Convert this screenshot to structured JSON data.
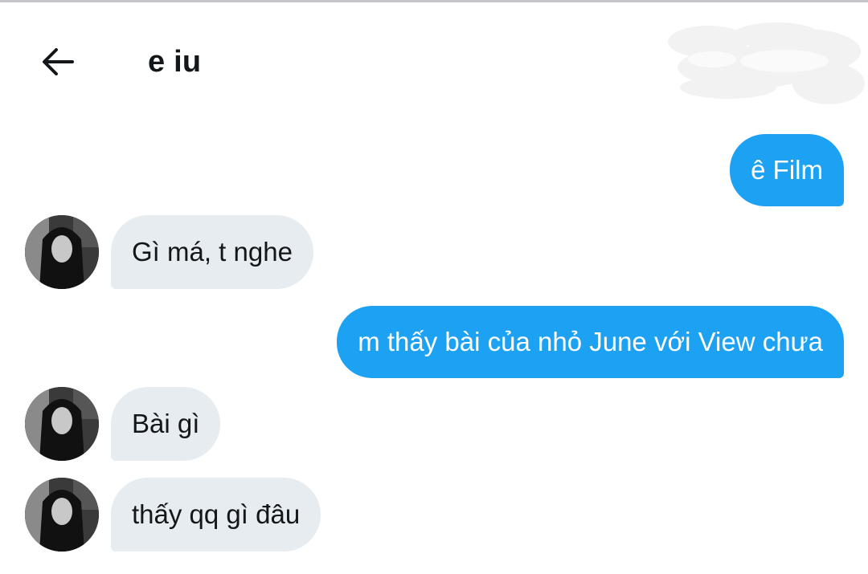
{
  "header": {
    "title": "e iu",
    "back_icon": "arrow-left-icon"
  },
  "colors": {
    "sent_bubble": "#1da1f2",
    "received_bubble": "#e6ecf0",
    "text_dark": "#14171a"
  },
  "messages": [
    {
      "direction": "sent",
      "text": "ê Film"
    },
    {
      "direction": "received",
      "text": "Gì má, t nghe"
    },
    {
      "direction": "sent",
      "text": "m thấy bài của nhỏ June với View chưa"
    },
    {
      "direction": "received",
      "text": "Bài gì"
    },
    {
      "direction": "received",
      "text": "thấy qq gì đâu"
    }
  ]
}
